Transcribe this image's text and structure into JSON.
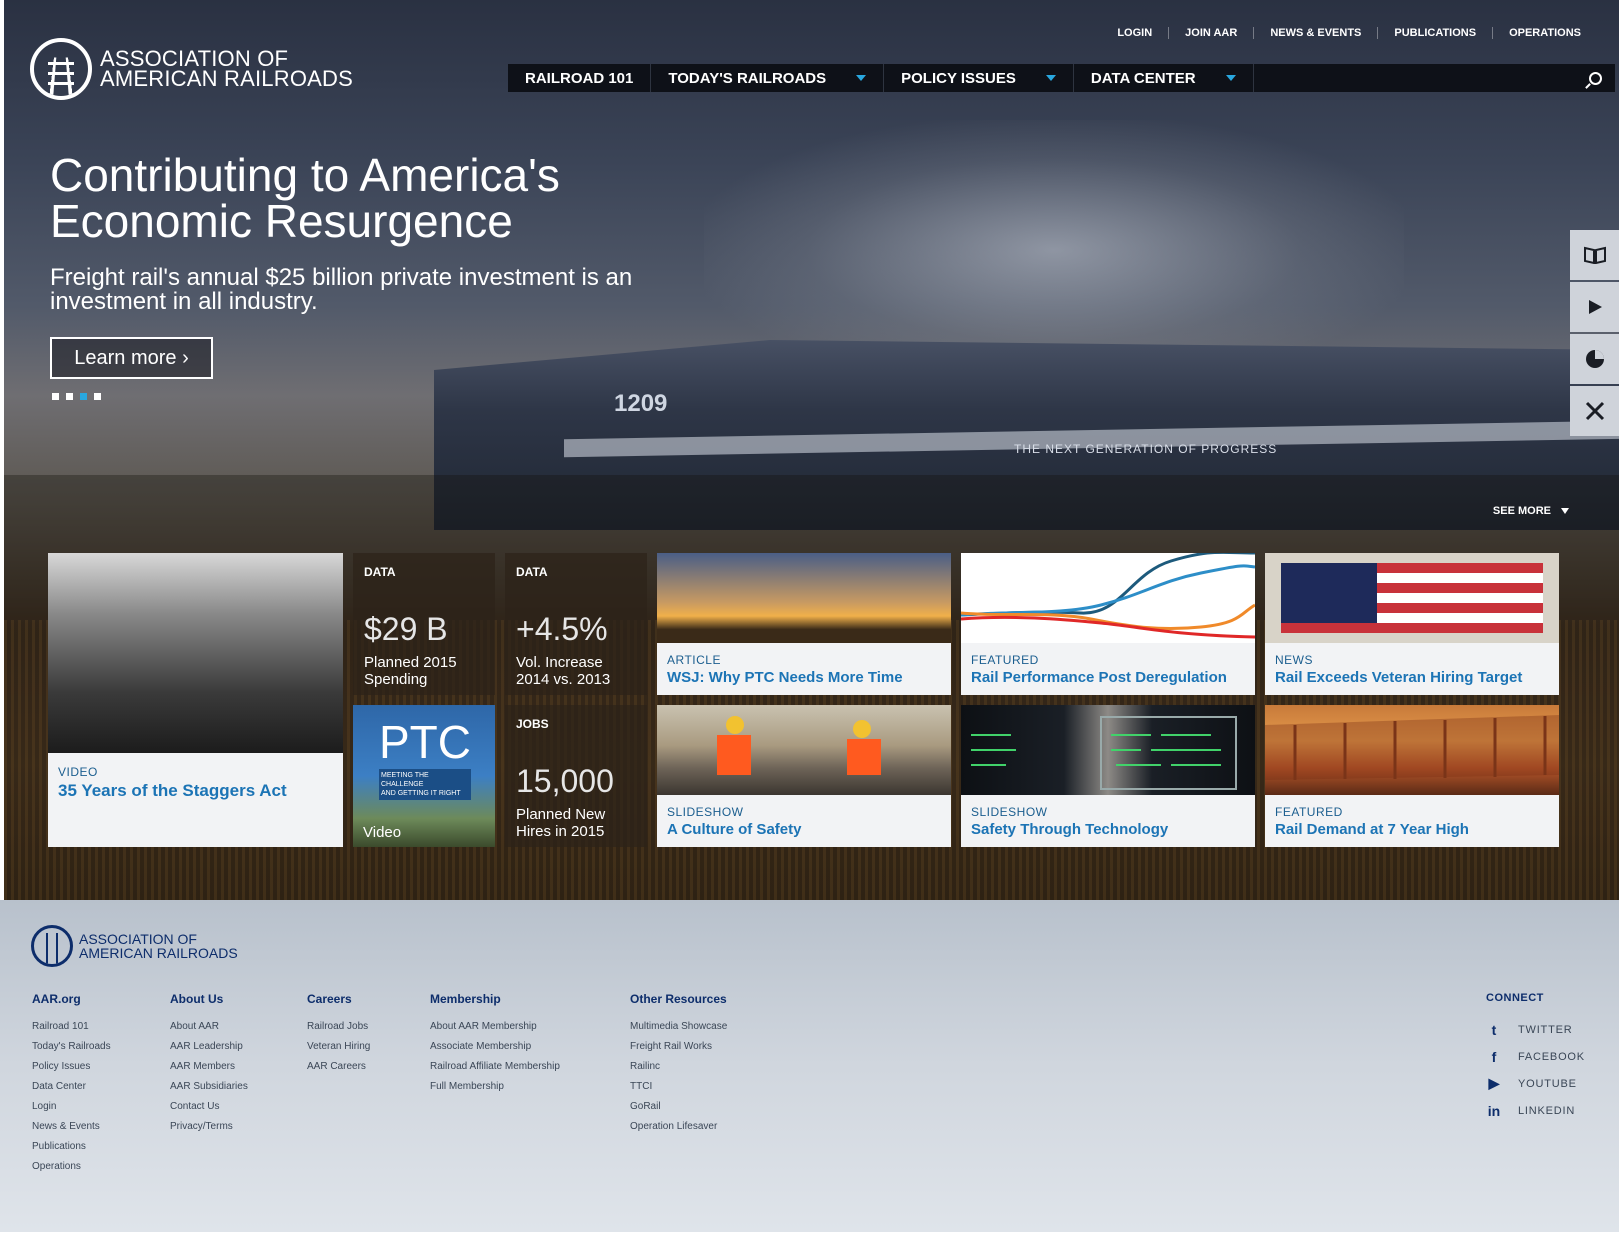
{
  "logo": {
    "line1": "ASSOCIATION OF",
    "line2": "AMERICAN RAILROADS"
  },
  "top_links": [
    "LOGIN",
    "JOIN AAR",
    "NEWS & EVENTS",
    "PUBLICATIONS",
    "OPERATIONS"
  ],
  "nav": [
    {
      "label": "RAILROAD 101",
      "dropdown": false
    },
    {
      "label": "TODAY'S RAILROADS",
      "dropdown": true
    },
    {
      "label": "POLICY ISSUES",
      "dropdown": true
    },
    {
      "label": "DATA CENTER",
      "dropdown": true
    }
  ],
  "hero": {
    "headline": "Contributing to America's Economic Resurgence",
    "subhead": "Freight rail's annual $25 billion private investment is an investment in all industry.",
    "cta": "Learn more ›",
    "slides": 4,
    "active_slide": 3,
    "train_number": "1209",
    "train_slogan": "THE NEXT GENERATION OF PROGRESS"
  },
  "side_tools": [
    "book-icon",
    "play-icon",
    "pie-chart-icon",
    "tools-icon"
  ],
  "see_more": "SEE MORE",
  "tiles": [
    {
      "kind": "VIDEO",
      "title": "35 Years of the Staggers Act"
    },
    {
      "kind": "DATA",
      "big": "$29 B",
      "desc": "Planned 2015 Spending"
    },
    {
      "kind": "DATA",
      "big": "+4.5%",
      "desc": "Vol. Increase 2014 vs. 2013"
    },
    {
      "kind": "ARTICLE",
      "title": "WSJ: Why PTC Needs More Time"
    },
    {
      "kind": "FEATURED",
      "title": "Rail Performance Post Deregulation"
    },
    {
      "kind": "NEWS",
      "title": "Rail Exceeds Veteran Hiring Target"
    },
    {
      "kind": "PTC",
      "ptc_big": "PTC",
      "ptc_sub1": "MEETING THE CHALLENGE",
      "ptc_sub2": "AND GETTING IT RIGHT",
      "label": "Video"
    },
    {
      "kind": "JOBS",
      "big": "15,000",
      "desc": "Planned New Hires in 2015"
    },
    {
      "kind": "SLIDESHOW",
      "title": "A Culture of Safety"
    },
    {
      "kind": "SLIDESHOW",
      "title": "Safety Through Technology"
    },
    {
      "kind": "FEATURED",
      "title": "Rail Demand at 7 Year High"
    }
  ],
  "footer": {
    "logo": {
      "line1": "ASSOCIATION OF",
      "line2": "AMERICAN RAILROADS"
    },
    "columns": [
      {
        "heading": "AAR.org",
        "links": [
          "Railroad 101",
          "Today's Railroads",
          "Policy Issues",
          "Data Center",
          "Login",
          "News & Events",
          "Publications",
          "Operations"
        ]
      },
      {
        "heading": "About Us",
        "links": [
          "About AAR",
          "AAR Leadership",
          "AAR Members",
          "AAR Subsidiaries",
          "Contact Us",
          "Privacy/Terms"
        ]
      },
      {
        "heading": "Careers",
        "links": [
          "Railroad Jobs",
          "Veteran Hiring",
          "AAR Careers"
        ]
      },
      {
        "heading": "Membership",
        "links": [
          "About AAR Membership",
          "Associate Membership",
          "Railroad Affiliate Membership",
          "Full Membership"
        ]
      },
      {
        "heading": "Other Resources",
        "links": [
          "Multimedia Showcase",
          "Freight Rail Works",
          "Railinc",
          "TTCI",
          "GoRail",
          "Operation Lifesaver"
        ]
      }
    ],
    "connect": {
      "heading": "CONNECT",
      "items": [
        {
          "icon": "twitter-icon",
          "glyph": "t",
          "label": "TWITTER"
        },
        {
          "icon": "facebook-icon",
          "glyph": "f",
          "label": "FACEBOOK"
        },
        {
          "icon": "youtube-icon",
          "glyph": "▶",
          "label": "YOUTUBE"
        },
        {
          "icon": "linkedin-icon",
          "glyph": "in",
          "label": "LINKEDIN"
        }
      ]
    }
  },
  "colors": {
    "accent": "#29a8e0",
    "link": "#1c74b5",
    "footer_text": "#0d2d6b"
  }
}
